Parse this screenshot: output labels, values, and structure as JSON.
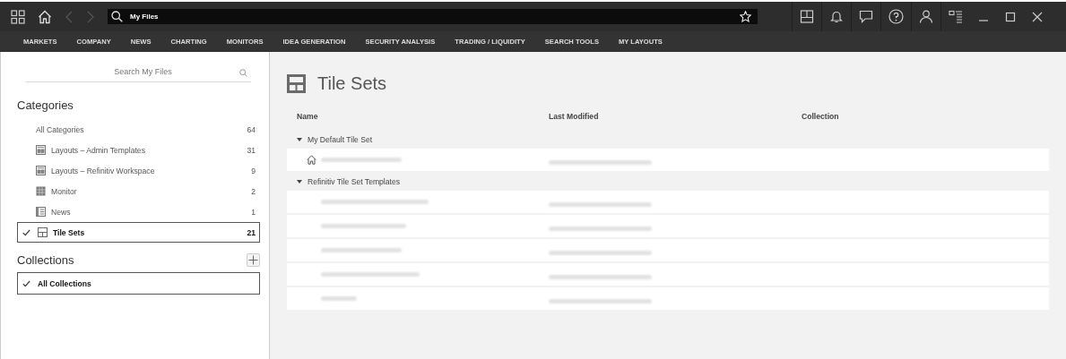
{
  "address_bar": {
    "value": "My Files"
  },
  "menu": [
    "MARKETS",
    "COMPANY",
    "NEWS",
    "CHARTING",
    "MONITORS",
    "IDEA GENERATION",
    "SECURITY ANALYSIS",
    "TRADING / LIQUIDITY",
    "SEARCH TOOLS",
    "MY LAYOUTS"
  ],
  "sidebar": {
    "search": {
      "placeholder": "Search My Files"
    },
    "categories_heading": "Categories",
    "categories": [
      {
        "kind": "all",
        "label": "All Categories",
        "count": "64",
        "selected": false
      },
      {
        "kind": "layout",
        "label": "Layouts – Admin Templates",
        "count": "31",
        "selected": false
      },
      {
        "kind": "layout",
        "label": "Layouts – Refinitiv Workspace",
        "count": "9",
        "selected": false
      },
      {
        "kind": "monitor",
        "label": "Monitor",
        "count": "2",
        "selected": false
      },
      {
        "kind": "news",
        "label": "News",
        "count": "1",
        "selected": false
      },
      {
        "kind": "tileset",
        "label": "Tile Sets",
        "count": "21",
        "selected": true
      }
    ],
    "collections_heading": "Collections",
    "collections": [
      {
        "label": "All Collections",
        "selected": true
      }
    ]
  },
  "main": {
    "title": "Tile Sets",
    "columns": [
      "Name",
      "Last Modified",
      "Collection"
    ],
    "groups": [
      {
        "label": "My Default Tile Set",
        "expanded": true,
        "rows": [
          {
            "default": true
          }
        ]
      },
      {
        "label": "Refinitiv Tile Set Templates",
        "expanded": true,
        "rows": [
          {
            "default": false
          },
          {
            "default": false
          },
          {
            "default": false
          },
          {
            "default": false
          },
          {
            "default": false
          }
        ]
      }
    ]
  }
}
